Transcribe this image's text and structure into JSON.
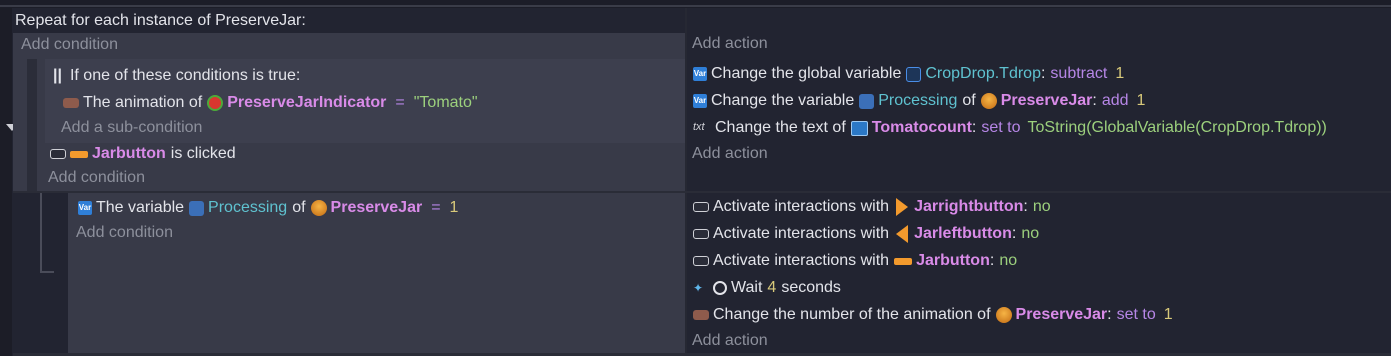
{
  "event": {
    "header": "Repeat for each instance of PreserveJar:"
  },
  "labels": {
    "add_condition": "Add condition",
    "add_action": "Add action",
    "add_sub_condition": "Add a sub-condition"
  },
  "or_block": {
    "title": "If one of these conditions is true:"
  },
  "cond_anim": {
    "prefix": "The animation of",
    "object": "PreserveJarIndicator",
    "op": "=",
    "value": "\"Tomato\""
  },
  "cond_click": {
    "object": "Jarbutton",
    "suffix": "is clicked"
  },
  "actions_top": {
    "global": {
      "prefix": "Change the global variable",
      "variable": "CropDrop.Tdrop",
      "colon": ":",
      "op": "subtract",
      "value": "1"
    },
    "var": {
      "prefix": "Change the variable",
      "variable": "Processing",
      "of": "of",
      "object": "PreserveJar",
      "colon": ":",
      "op": "add",
      "value": "1"
    },
    "text": {
      "icon": "txt",
      "prefix": "Change the text of",
      "object": "Tomatocount",
      "colon": ":",
      "op": "set to",
      "value": "ToString(GlobalVariable(CropDrop.Tdrop))"
    }
  },
  "sub_cond": {
    "prefix": "The variable",
    "variable": "Processing",
    "of": "of",
    "object": "PreserveJar",
    "op": "=",
    "value": "1"
  },
  "actions_bottom": {
    "act1": {
      "prefix": "Activate interactions with",
      "object": "Jarrightbutton",
      "colon": ":",
      "value": "no"
    },
    "act2": {
      "prefix": "Activate interactions with",
      "object": "Jarleftbutton",
      "colon": ":",
      "value": "no"
    },
    "act3": {
      "prefix": "Activate interactions with",
      "object": "Jarbutton",
      "colon": ":",
      "value": "no"
    },
    "wait": {
      "prefix": "Wait",
      "value": "4",
      "suffix": "seconds"
    },
    "anim": {
      "prefix": "Change the number of the animation of",
      "object": "PreserveJar",
      "colon": ":",
      "op": "set to",
      "value": "1"
    }
  },
  "colors": {
    "background": "#222431",
    "condition_panel": "#3a3c4b",
    "object": "#d98be8",
    "variable": "#5fc2d0",
    "operator": "#b686e6",
    "number": "#d8c97a",
    "string": "#9cd07d"
  }
}
